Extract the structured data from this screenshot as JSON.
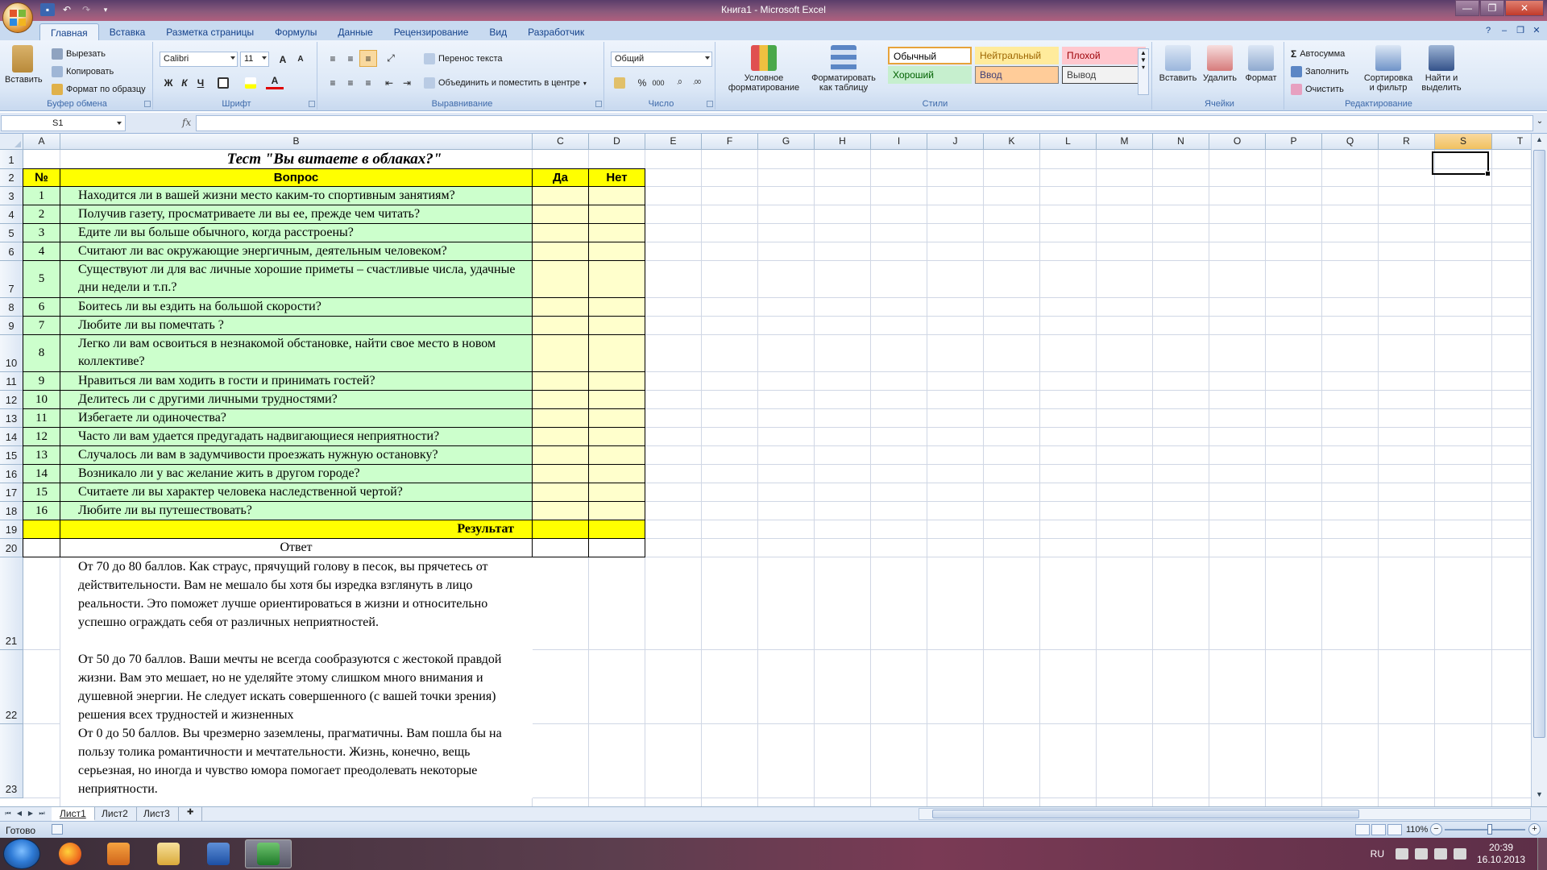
{
  "window": {
    "title": "Книга1 - Microsoft Excel",
    "controls": [
      "—",
      "❐",
      "✕"
    ]
  },
  "tabs": [
    "Главная",
    "Вставка",
    "Разметка страницы",
    "Формулы",
    "Данные",
    "Рецензирование",
    "Вид",
    "Разработчик"
  ],
  "ribbon": {
    "clipboard": {
      "label": "Буфер обмена",
      "paste": "Вставить",
      "cut": "Вырезать",
      "copy": "Копировать",
      "format_painter": "Формат по образцу"
    },
    "font": {
      "label": "Шрифт",
      "name": "Calibri",
      "size": "11",
      "bold": "Ж",
      "italic": "К",
      "underline": "Ч",
      "grow": "A",
      "shrink": "A",
      "font_color_letter": "A"
    },
    "alignment": {
      "label": "Выравнивание",
      "wrap": "Перенос текста",
      "merge": "Объединить и поместить в центре"
    },
    "number": {
      "label": "Число",
      "format": "Общий",
      "percent": "%",
      "thousands": "000",
      "inc": ",0\n,00",
      "dec": ",00\n,0"
    },
    "styles": {
      "label": "Стили",
      "conditional": "Условное форматирование",
      "as_table": "Форматировать как таблицу",
      "cells": [
        {
          "text": "Обычный",
          "bg": "#ffffff",
          "color": "#000000",
          "border": "#e7a33a"
        },
        {
          "text": "Нейтральный",
          "bg": "#ffeb9c",
          "color": "#9c6500",
          "border": "#ffeb9c"
        },
        {
          "text": "Плохой",
          "bg": "#ffc7ce",
          "color": "#9c0006",
          "border": "#ffc7ce"
        },
        {
          "text": "Хороший",
          "bg": "#c6efce",
          "color": "#006100",
          "border": "#c6efce"
        },
        {
          "text": "Ввод",
          "bg": "#ffcc99",
          "color": "#3f3f76",
          "border": "#7f7f7f"
        },
        {
          "text": "Вывод",
          "bg": "#f2f2f2",
          "color": "#3f3f3f",
          "border": "#3f3f3f"
        }
      ]
    },
    "cells": {
      "label": "Ячейки",
      "insert": "Вставить",
      "delete": "Удалить",
      "format": "Формат"
    },
    "editing": {
      "label": "Редактирование",
      "autosum": "Автосумма",
      "fill": "Заполнить",
      "clear": "Очистить",
      "sort": "Сортировка и фильтр",
      "find": "Найти и выделить"
    }
  },
  "formula_bar": {
    "name_box": "S1",
    "fx": "fx",
    "value": ""
  },
  "columns": [
    "A",
    "B",
    "C",
    "D",
    "E",
    "F",
    "G",
    "H",
    "I",
    "J",
    "K",
    "L",
    "M",
    "N",
    "O",
    "P",
    "Q",
    "R",
    "S",
    "T"
  ],
  "selected_column": "S",
  "rows": [
    "1",
    "2",
    "3",
    "4",
    "5",
    "6",
    "7",
    "8",
    "9",
    "10",
    "11",
    "12",
    "13",
    "14",
    "15",
    "16",
    "17",
    "18",
    "19",
    "20",
    "21",
    "22",
    "23"
  ],
  "sheet": {
    "title": "Тест \"Вы витаете в облаках?\"",
    "headers": {
      "num": "№",
      "question": "Вопрос",
      "yes": "Да",
      "no": "Нет"
    },
    "questions": [
      {
        "n": "1",
        "text": "Находится ли в вашей жизни место каким-то спортивным занятиям?"
      },
      {
        "n": "2",
        "text": "Получив газету, просматриваете ли вы ее, прежде чем читать?"
      },
      {
        "n": "3",
        "text": "Едите ли вы больше обычного, когда расстроены?"
      },
      {
        "n": "4",
        "text": "Считают ли вас окружающие энергичным, деятельным человеком?"
      },
      {
        "n": "5",
        "text": " Существуют ли для вас личные хорошие приметы – счастливые числа, удачные дни недели и т.п.?"
      },
      {
        "n": "6",
        "text": " Боитесь ли вы ездить на большой скорости?"
      },
      {
        "n": "7",
        "text": "Любите ли вы помечтать ?"
      },
      {
        "n": "8",
        "text": "Легко ли вам освоиться в незнакомой обстановке, найти свое место в новом коллективе?"
      },
      {
        "n": "9",
        "text": "Нравиться ли вам ходить в гости и принимать гостей?"
      },
      {
        "n": "10",
        "text": "Делитесь ли с другими личными трудностями?"
      },
      {
        "n": "11",
        "text": "Избегаете ли одиночества?"
      },
      {
        "n": "12",
        "text": "Часто ли вам удается предугадать надвигающиеся неприятности?"
      },
      {
        "n": "13",
        "text": "Случалось ли вам в задумчивости проезжать нужную остановку?"
      },
      {
        "n": "14",
        "text": "Возникало ли у вас желание жить в другом городе?"
      },
      {
        "n": "15",
        "text": "Считаете ли вы характер человека наследственной чертой?"
      },
      {
        "n": "16",
        "text": "Любите ли вы путешествовать?"
      }
    ],
    "result_label": "Результат",
    "answer_label": "Ответ",
    "answers": [
      "От 70 до 80 баллов. Как страус, прячущий голову в песок, вы прячетесь от действительности. Вам не мешало бы хотя бы изредка взглянуть в лицо реальности. Это поможет лучше ориентироваться в жизни и относительно успешно ограждать себя от различных неприятностей.",
      "От 50 до 70 баллов. Ваши мечты не всегда сообразуются с жестокой правдой жизни. Вам это мешает, но не уделяйте этому слишком много внимания и душевной энергии. Не следует искать совершенного (с вашей точки зрения) решения всех трудностей и жизненных",
      "От 0 до 50 баллов. Вы чрезмерно заземлены, прагматичны. Вам пошла бы на пользу толика романтичности и мечтательности. Жизнь, конечно, вещь серьезная, но иногда и чувство юмора помогает преодолевать некоторые неприятности."
    ],
    "colors": {
      "yellow": "#ffff00",
      "green": "#ccffcc",
      "cream": "#ffffcc"
    }
  },
  "sheet_tabs": [
    "Лист1",
    "Лист2",
    "Лист3"
  ],
  "status": {
    "text": "Готово",
    "zoom": "110%"
  },
  "taskbar": {
    "apps": [
      "windows-start",
      "firefox",
      "media-player",
      "file-explorer",
      "word",
      "excel"
    ],
    "lang": "RU",
    "time": "20:39",
    "date": "16.10.2013"
  }
}
